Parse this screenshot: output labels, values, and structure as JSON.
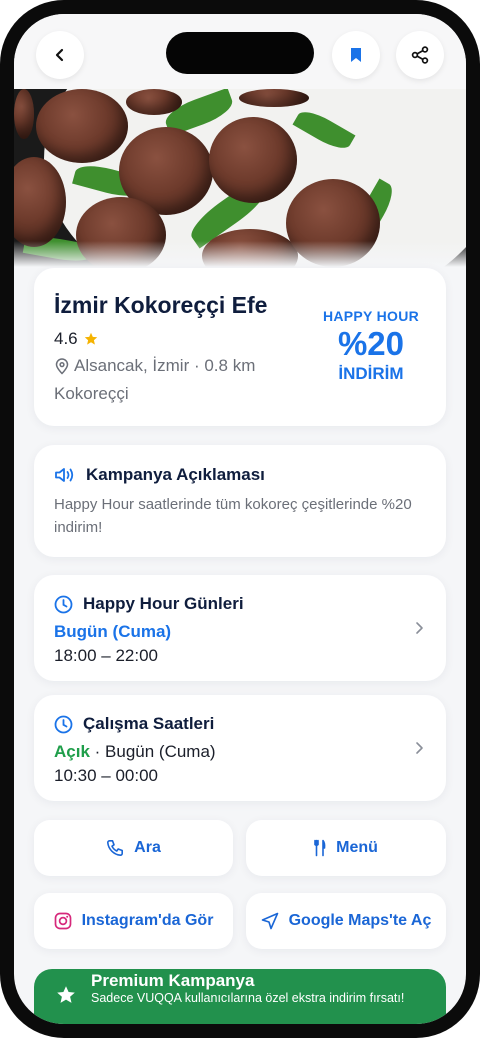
{
  "place": {
    "name": "İzmir Kokoreççi Efe",
    "rating": "4.6",
    "location": "Alsancak, İzmir · 0.8 km",
    "category": "Kokoreççi"
  },
  "deal": {
    "label_top": "HAPPY HOUR",
    "label_big": "%20",
    "label_bottom": "İNDİRİM"
  },
  "campaign": {
    "title": "Kampanya Açıklaması",
    "description": "Happy Hour saatlerinde tüm kokoreç çeşitlerinde %20 indirim!"
  },
  "happy_hour_days": {
    "title": "Happy Hour Günleri",
    "day": "Bugün (Cuma)",
    "hours": "18:00 – 22:00"
  },
  "working_hours": {
    "title": "Çalışma Saatleri",
    "status": "Açık",
    "day": " · Bugün (Cuma)",
    "hours": "10:30 – 00:00"
  },
  "actions": {
    "call": "Ara",
    "menu": "Menü",
    "instagram": "Instagram'da Gör",
    "maps": "Google Maps'te Aç"
  },
  "premium": {
    "title": "Premium Kampanya",
    "subtitle": "Sadece VUQQA kullanıcılarına özel ekstra indirim fırsatı!"
  },
  "colors": {
    "accent_blue": "#1a73e8",
    "open_green": "#1f9e4a",
    "premium_green": "#22914d",
    "star": "#f5b301",
    "title_navy": "#0f1d3d"
  },
  "icons": [
    "back-icon",
    "bookmark-icon",
    "share-icon",
    "star-icon",
    "location-pin-icon",
    "speaker-icon",
    "clock-icon",
    "chevron-right-icon",
    "phone-icon",
    "fork-knife-icon",
    "instagram-icon",
    "navigation-arrow-icon"
  ]
}
